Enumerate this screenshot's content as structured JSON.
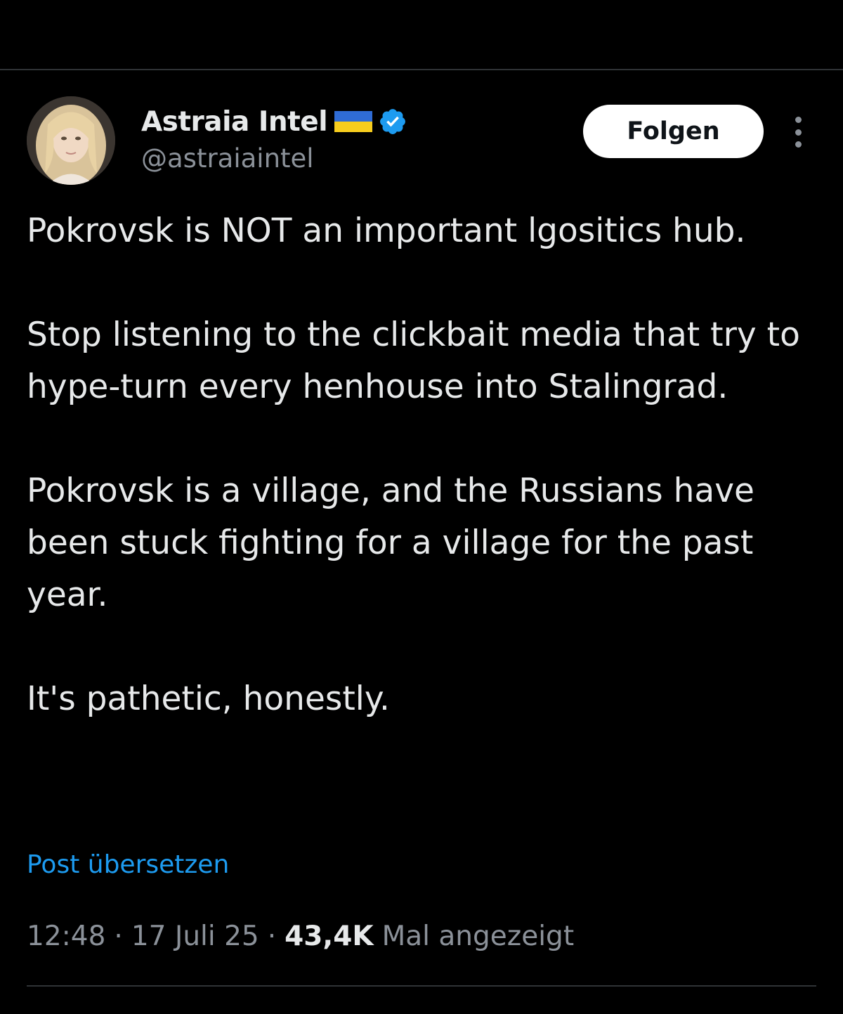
{
  "author": {
    "display_name": "Astraia Intel",
    "handle": "@astraiaintel",
    "flag_icon": "ukraine-flag-icon",
    "verified_icon": "verified-badge-icon",
    "verified_color": "#1d9bf0"
  },
  "actions": {
    "follow_label": "Folgen",
    "more_icon": "more-vertical-icon"
  },
  "tweet": {
    "paragraphs": [
      "Pokrovsk is NOT an important lgositics hub.",
      "Stop listening to the clickbait media that try to hype-turn every henhouse into Stalingrad.",
      "Pokrovsk is a village, and the Russians have been stuck fighting for a village for the past year.",
      "It's pathetic, honestly."
    ],
    "translate_label": "Post übersetzen"
  },
  "meta": {
    "time": "12:48",
    "separator": "·",
    "date": "17 Juli 25",
    "views_count": "43,4K",
    "views_label": "Mal angezeigt"
  },
  "colors": {
    "background": "#000000",
    "text_primary": "#e7e9ea",
    "text_secondary": "#8b9199",
    "link": "#1d9bf0",
    "divider": "#2f3336"
  }
}
